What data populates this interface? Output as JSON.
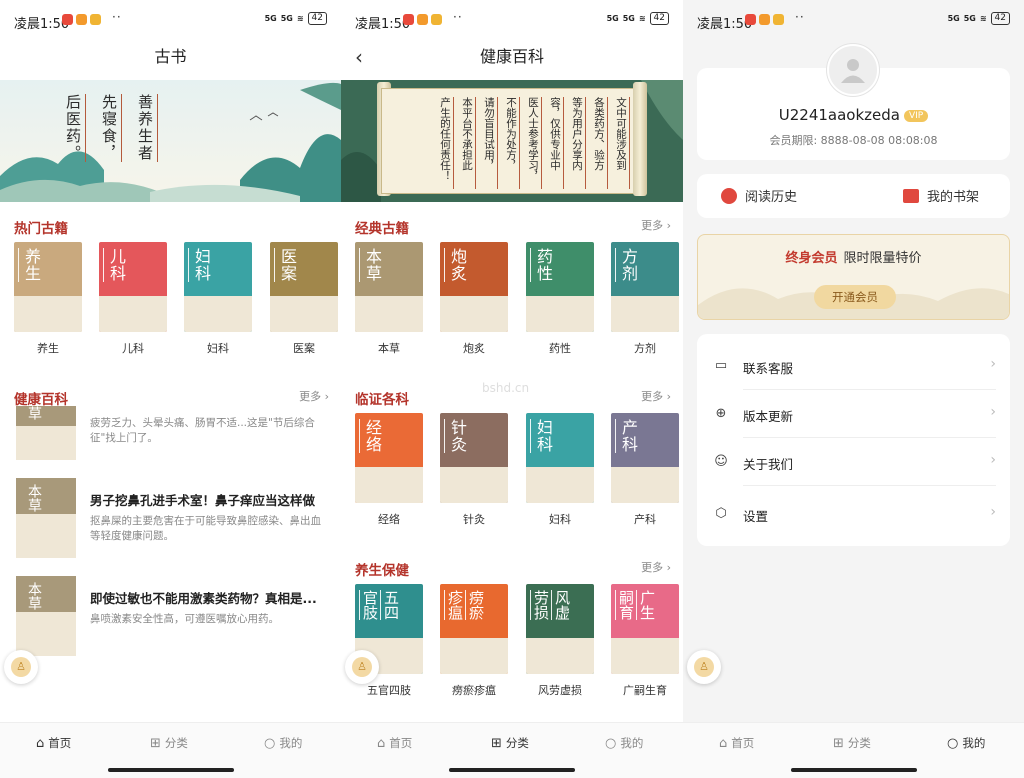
{
  "status": {
    "time": "凌晨1:50",
    "dots": "··",
    "signal1": "5G",
    "signal2": "5G",
    "battery": "42",
    "app_icon_colors": [
      "#e8493b",
      "#f39a2c",
      "#f0b433"
    ]
  },
  "colors": {
    "accent_red": "#b4342b",
    "vip_gold": "#f2c55c"
  },
  "screen1": {
    "title": "古书",
    "poem": [
      "善养生者",
      "先寝食，",
      "后医药。"
    ],
    "hot_section": "热门古籍",
    "hot_books": [
      {
        "cover": "养生",
        "label": "养生",
        "color": "#c9a97e"
      },
      {
        "cover": "儿科",
        "label": "儿科",
        "color": "#e4575b"
      },
      {
        "cover": "妇科",
        "label": "妇科",
        "color": "#3aa3a4"
      },
      {
        "cover": "医案",
        "label": "医案",
        "color": "#a1874b"
      }
    ],
    "health_section": "健康百科",
    "more": "更多",
    "articles": [
      {
        "thumb": "草",
        "title": "",
        "desc": "疲劳乏力、头晕头痛、肠胃不适...这是\"节后综合征\"找上门了。"
      },
      {
        "thumb": "本草",
        "title": "男子挖鼻孔进手术室！鼻子痒应当这样做",
        "desc": "抠鼻屎的主要危害在于可能导致鼻腔感染、鼻出血等轻度健康问题。"
      },
      {
        "thumb": "本草",
        "title": "即使过敏也不能用激素类药物？真相是...",
        "desc": "鼻喷激素安全性高，可遵医嘱放心用药。"
      }
    ]
  },
  "screen2": {
    "title": "健康百科",
    "back": "‹",
    "notice": [
      "文中可能涉及到",
      "各类药方、验方",
      "等为用户分享内",
      "容，仅供专业中",
      "医人士参考学习，",
      "不能作为处方，",
      "请勿盲目试用，",
      "本平台不承担此",
      "产生的任何责任！"
    ],
    "more": "更多",
    "sections": [
      {
        "title": "经典古籍",
        "books": [
          {
            "cover": "本草",
            "label": "本草",
            "color": "#ab9872"
          },
          {
            "cover": "炮炙",
            "label": "炮炙",
            "color": "#c35a2e"
          },
          {
            "cover": "药性",
            "label": "药性",
            "color": "#3f8e6a"
          },
          {
            "cover": "方剂",
            "label": "方剂",
            "color": "#3c8c8a"
          }
        ]
      },
      {
        "title": "临证各科",
        "books": [
          {
            "cover": "经络",
            "label": "经络",
            "color": "#ea6a36"
          },
          {
            "cover": "针灸",
            "label": "针灸",
            "color": "#8c6d60"
          },
          {
            "cover": "妇科",
            "label": "妇科",
            "color": "#3aa3a4"
          },
          {
            "cover": "产科",
            "label": "产科",
            "color": "#7a7793"
          }
        ]
      },
      {
        "title": "养生保健",
        "books": [
          {
            "cover": [
              "五四",
              "官肢"
            ],
            "label": "五官四肢",
            "color": "#2f8f8e"
          },
          {
            "cover": [
              "痨瘀",
              "疹瘟"
            ],
            "label": "痨瘀疹瘟",
            "color": "#e8692f"
          },
          {
            "cover": [
              "风虚",
              "劳损"
            ],
            "label": "风劳虚损",
            "color": "#3b6e53"
          },
          {
            "cover": [
              "广生",
              "嗣育"
            ],
            "label": "广嗣生育",
            "color": "#e86a88"
          }
        ]
      }
    ],
    "watermark": "bshd.cn"
  },
  "screen3": {
    "username": "U2241aaokzeda",
    "vip_badge": "VIP",
    "expire": "会员期限: 8888-08-08 08:08:08",
    "history": "阅读历史",
    "shelf": "我的书架",
    "vip_card_title": "终身会员",
    "vip_card_sub": "限时限量特价",
    "vip_card_button": "开通会员",
    "menu": [
      {
        "icon": "chat-icon",
        "glyph": "▭",
        "label": "联系客服"
      },
      {
        "icon": "upload-icon",
        "glyph": "⊕",
        "label": "版本更新"
      },
      {
        "icon": "user-icon",
        "glyph": "☺",
        "label": "关于我们"
      },
      {
        "icon": "settings-icon",
        "glyph": "⬡",
        "label": "设置"
      }
    ]
  },
  "tabs": {
    "home": "首页",
    "category": "分类",
    "mine": "我的"
  }
}
